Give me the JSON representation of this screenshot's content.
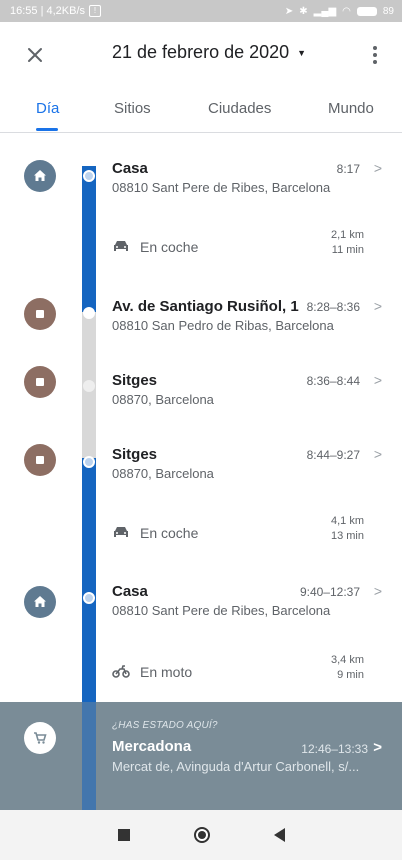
{
  "status_bar": {
    "time_speed": "16:55 | 4,2KB/s",
    "battery": "89"
  },
  "header": {
    "date": "21 de febrero de 2020"
  },
  "tabs": [
    {
      "label": "Día",
      "active": true
    },
    {
      "label": "Sitios",
      "active": false
    },
    {
      "label": "Ciudades",
      "active": false
    },
    {
      "label": "Mundo",
      "active": false
    }
  ],
  "timeline": {
    "places": [
      {
        "name": "Casa",
        "address": "08810 Sant Pere de Ribes, Barcelona",
        "time": "8:17",
        "icon": "home-icon"
      },
      {
        "name": "Av. de Santiago Rusiñol, 1",
        "address": "08810 San Pedro de Ribas, Barcelona",
        "time": "8:28–8:36",
        "icon": "place-icon"
      },
      {
        "name": "Sitges",
        "address": "08870, Barcelona",
        "time": "8:36–8:44",
        "icon": "place-icon"
      },
      {
        "name": "Sitges",
        "address": "08870, Barcelona",
        "time": "8:44–9:27",
        "icon": "place-icon"
      },
      {
        "name": "Casa",
        "address": "08810 Sant Pere de Ribes, Barcelona",
        "time": "9:40–12:37",
        "icon": "home-icon"
      }
    ],
    "moves": [
      {
        "mode": "En coche",
        "distance": "2,1 km",
        "duration": "11 min",
        "icon": "car-icon"
      },
      {
        "mode": "En coche",
        "distance": "4,1 km",
        "duration": "13 min",
        "icon": "car-icon"
      },
      {
        "mode": "En moto",
        "distance": "3,4 km",
        "duration": "9 min",
        "icon": "motorcycle-icon"
      }
    ]
  },
  "suggestion": {
    "question": "¿HAS ESTADO AQUÍ?",
    "name": "Mercadona",
    "time": "12:46–13:33",
    "address": "Mercat de, Avinguda d'Artur Carbonell, s/..."
  },
  "colors": {
    "accent": "#1a73e8",
    "timeline_blue": "#1565c0",
    "home_badge": "#5f7a91",
    "place_badge": "#8d6e63",
    "suggestion_bg": "#7a8c97"
  }
}
